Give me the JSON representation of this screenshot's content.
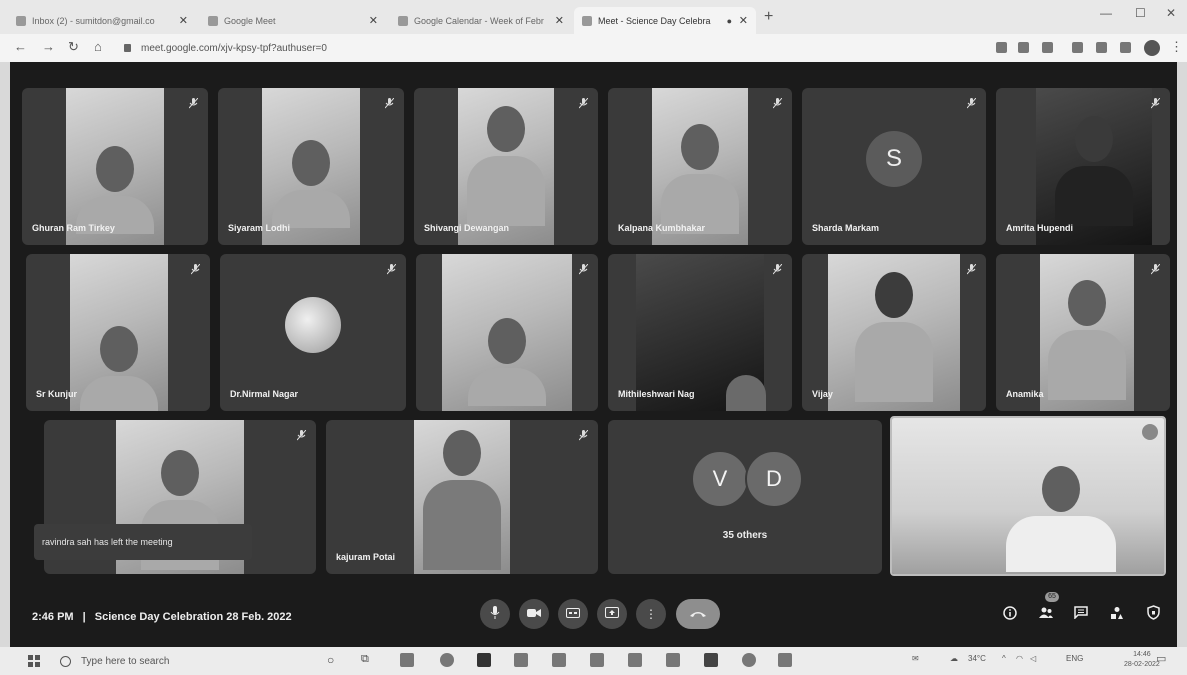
{
  "browser": {
    "tabs": [
      {
        "label": "Inbox (2) - sumitdon@gmail.co"
      },
      {
        "label": "Google Meet"
      },
      {
        "label": "Google Calendar - Week of Febr"
      },
      {
        "label": "Meet - Science Day Celebra"
      }
    ],
    "url": "meet.google.com/xjv-kpsy-tpf?authuser=0"
  },
  "meeting": {
    "time": "2:46 PM",
    "separator": "|",
    "title": "Science Day Celebration 28 Feb. 2022"
  },
  "participants": [
    {
      "name": "Ghuran Ram Tirkey",
      "type": "video"
    },
    {
      "name": "Siyaram Lodhi",
      "type": "video"
    },
    {
      "name": "Shivangi Dewangan",
      "type": "video"
    },
    {
      "name": "Kalpana Kumbhakar",
      "type": "video"
    },
    {
      "name": "Sharda Markam",
      "type": "initial",
      "initial": "S"
    },
    {
      "name": "Amrita Hupendi",
      "type": "video-dark"
    },
    {
      "name": "Sr Kunjur",
      "type": "video"
    },
    {
      "name": "Dr.Nirmal Nagar",
      "type": "photo"
    },
    {
      "name": "",
      "type": "video"
    },
    {
      "name": "Mithileshwari Nag",
      "type": "video-dark"
    },
    {
      "name": "Vijay",
      "type": "video"
    },
    {
      "name": "Anamika",
      "type": "video"
    },
    {
      "name": "",
      "type": "video"
    },
    {
      "name": "kajuram Potai",
      "type": "video"
    },
    {
      "name": "",
      "type": "others"
    },
    {
      "name": "",
      "type": "self"
    }
  ],
  "others": {
    "initials": [
      "V",
      "D"
    ],
    "label": "35 others"
  },
  "toast": "ravindra sah has left the meeting",
  "controls": {
    "people_count": "65"
  },
  "taskbar": {
    "search_placeholder": "Type here to search",
    "temperature": "34°C",
    "language": "ENG",
    "time": "14:46",
    "date": "28-02-2022"
  }
}
